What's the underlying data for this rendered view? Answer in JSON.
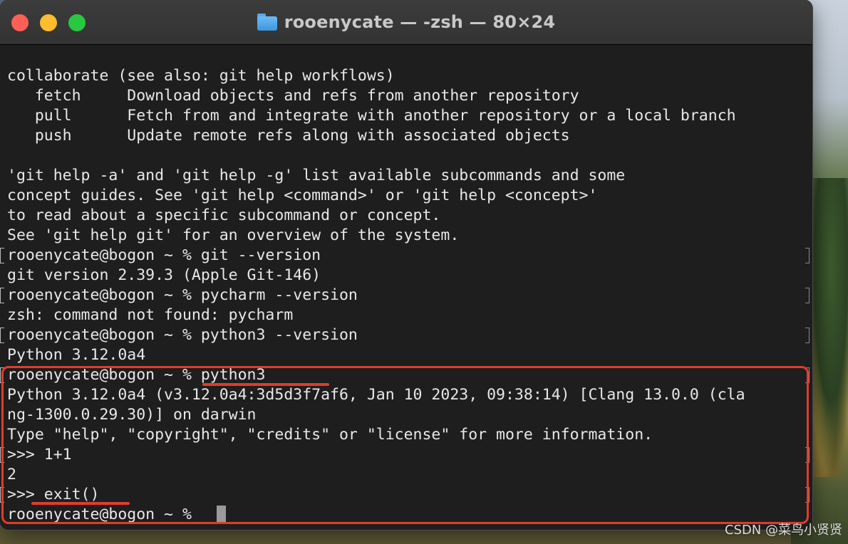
{
  "window": {
    "title": "rooenycate — -zsh — 80×24",
    "folder_icon": "folder-icon"
  },
  "terminal": {
    "lines": [
      "collaborate (see also: git help workflows)",
      "   fetch     Download objects and refs from another repository",
      "   pull      Fetch from and integrate with another repository or a local branch",
      "   push      Update remote refs along with associated objects",
      "",
      "'git help -a' and 'git help -g' list available subcommands and some",
      "concept guides. See 'git help <command>' or 'git help <concept>'",
      "to read about a specific subcommand or concept.",
      "See 'git help git' for an overview of the system.",
      "rooenycate@bogon ~ % git --version",
      "git version 2.39.3 (Apple Git-146)",
      "rooenycate@bogon ~ % pycharm --version",
      "zsh: command not found: pycharm",
      "rooenycate@bogon ~ % python3 --version",
      "Python 3.12.0a4",
      "rooenycate@bogon ~ % python3",
      "Python 3.12.0a4 (v3.12.0a4:3d5d3f7af6, Jan 10 2023, 09:38:14) [Clang 13.0.0 (cla",
      "ng-1300.0.29.30)] on darwin",
      "Type \"help\", \"copyright\", \"credits\" or \"license\" for more information.",
      ">>> 1+1",
      "2",
      ">>> exit()",
      "rooenycate@bogon ~ % "
    ]
  },
  "annotation": {
    "color": "#e03c2c"
  },
  "watermark": "CSDN @菜鸟小贤贤"
}
